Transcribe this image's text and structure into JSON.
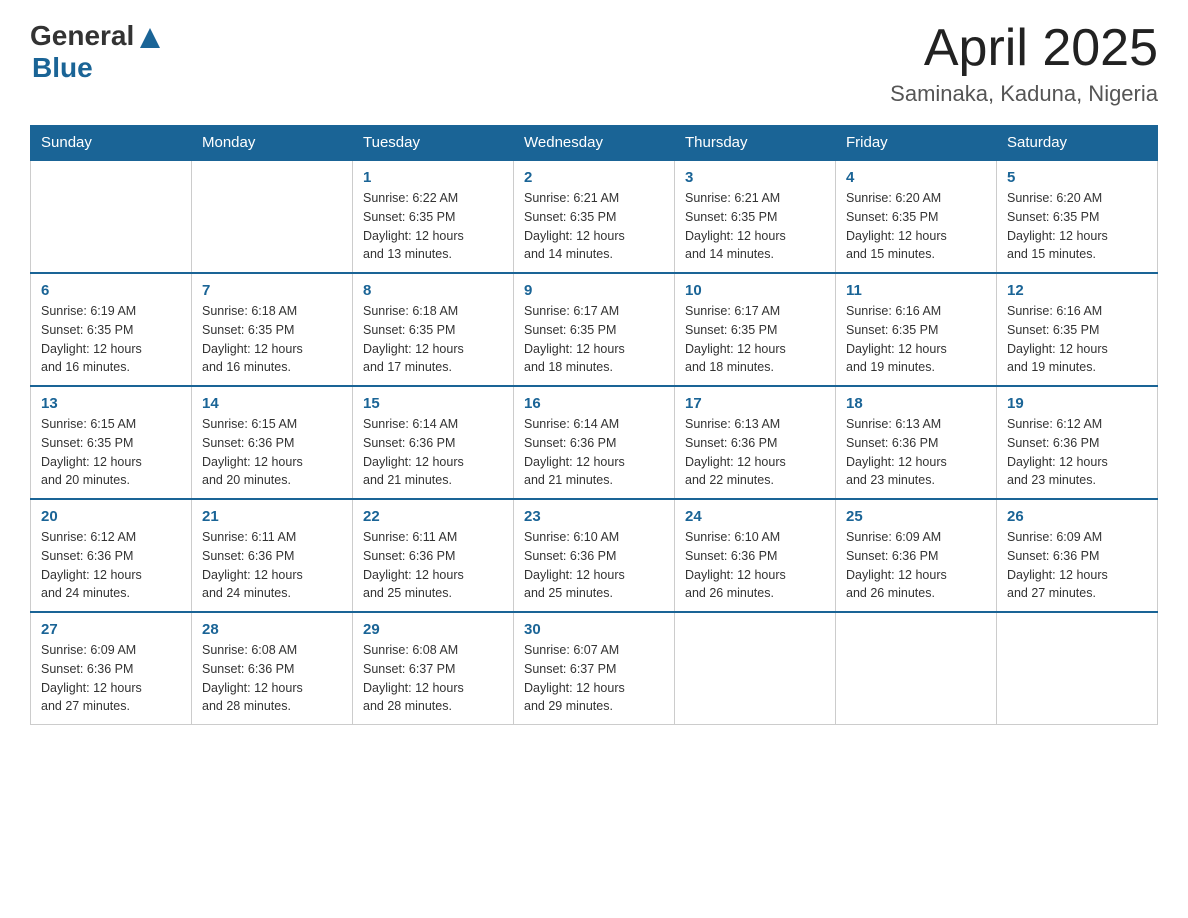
{
  "header": {
    "logo_general": "General",
    "logo_blue": "Blue",
    "title": "April 2025",
    "subtitle": "Saminaka, Kaduna, Nigeria"
  },
  "weekdays": [
    "Sunday",
    "Monday",
    "Tuesday",
    "Wednesday",
    "Thursday",
    "Friday",
    "Saturday"
  ],
  "weeks": [
    [
      {
        "day": "",
        "info": ""
      },
      {
        "day": "",
        "info": ""
      },
      {
        "day": "1",
        "info": "Sunrise: 6:22 AM\nSunset: 6:35 PM\nDaylight: 12 hours\nand 13 minutes."
      },
      {
        "day": "2",
        "info": "Sunrise: 6:21 AM\nSunset: 6:35 PM\nDaylight: 12 hours\nand 14 minutes."
      },
      {
        "day": "3",
        "info": "Sunrise: 6:21 AM\nSunset: 6:35 PM\nDaylight: 12 hours\nand 14 minutes."
      },
      {
        "day": "4",
        "info": "Sunrise: 6:20 AM\nSunset: 6:35 PM\nDaylight: 12 hours\nand 15 minutes."
      },
      {
        "day": "5",
        "info": "Sunrise: 6:20 AM\nSunset: 6:35 PM\nDaylight: 12 hours\nand 15 minutes."
      }
    ],
    [
      {
        "day": "6",
        "info": "Sunrise: 6:19 AM\nSunset: 6:35 PM\nDaylight: 12 hours\nand 16 minutes."
      },
      {
        "day": "7",
        "info": "Sunrise: 6:18 AM\nSunset: 6:35 PM\nDaylight: 12 hours\nand 16 minutes."
      },
      {
        "day": "8",
        "info": "Sunrise: 6:18 AM\nSunset: 6:35 PM\nDaylight: 12 hours\nand 17 minutes."
      },
      {
        "day": "9",
        "info": "Sunrise: 6:17 AM\nSunset: 6:35 PM\nDaylight: 12 hours\nand 18 minutes."
      },
      {
        "day": "10",
        "info": "Sunrise: 6:17 AM\nSunset: 6:35 PM\nDaylight: 12 hours\nand 18 minutes."
      },
      {
        "day": "11",
        "info": "Sunrise: 6:16 AM\nSunset: 6:35 PM\nDaylight: 12 hours\nand 19 minutes."
      },
      {
        "day": "12",
        "info": "Sunrise: 6:16 AM\nSunset: 6:35 PM\nDaylight: 12 hours\nand 19 minutes."
      }
    ],
    [
      {
        "day": "13",
        "info": "Sunrise: 6:15 AM\nSunset: 6:35 PM\nDaylight: 12 hours\nand 20 minutes."
      },
      {
        "day": "14",
        "info": "Sunrise: 6:15 AM\nSunset: 6:36 PM\nDaylight: 12 hours\nand 20 minutes."
      },
      {
        "day": "15",
        "info": "Sunrise: 6:14 AM\nSunset: 6:36 PM\nDaylight: 12 hours\nand 21 minutes."
      },
      {
        "day": "16",
        "info": "Sunrise: 6:14 AM\nSunset: 6:36 PM\nDaylight: 12 hours\nand 21 minutes."
      },
      {
        "day": "17",
        "info": "Sunrise: 6:13 AM\nSunset: 6:36 PM\nDaylight: 12 hours\nand 22 minutes."
      },
      {
        "day": "18",
        "info": "Sunrise: 6:13 AM\nSunset: 6:36 PM\nDaylight: 12 hours\nand 23 minutes."
      },
      {
        "day": "19",
        "info": "Sunrise: 6:12 AM\nSunset: 6:36 PM\nDaylight: 12 hours\nand 23 minutes."
      }
    ],
    [
      {
        "day": "20",
        "info": "Sunrise: 6:12 AM\nSunset: 6:36 PM\nDaylight: 12 hours\nand 24 minutes."
      },
      {
        "day": "21",
        "info": "Sunrise: 6:11 AM\nSunset: 6:36 PM\nDaylight: 12 hours\nand 24 minutes."
      },
      {
        "day": "22",
        "info": "Sunrise: 6:11 AM\nSunset: 6:36 PM\nDaylight: 12 hours\nand 25 minutes."
      },
      {
        "day": "23",
        "info": "Sunrise: 6:10 AM\nSunset: 6:36 PM\nDaylight: 12 hours\nand 25 minutes."
      },
      {
        "day": "24",
        "info": "Sunrise: 6:10 AM\nSunset: 6:36 PM\nDaylight: 12 hours\nand 26 minutes."
      },
      {
        "day": "25",
        "info": "Sunrise: 6:09 AM\nSunset: 6:36 PM\nDaylight: 12 hours\nand 26 minutes."
      },
      {
        "day": "26",
        "info": "Sunrise: 6:09 AM\nSunset: 6:36 PM\nDaylight: 12 hours\nand 27 minutes."
      }
    ],
    [
      {
        "day": "27",
        "info": "Sunrise: 6:09 AM\nSunset: 6:36 PM\nDaylight: 12 hours\nand 27 minutes."
      },
      {
        "day": "28",
        "info": "Sunrise: 6:08 AM\nSunset: 6:36 PM\nDaylight: 12 hours\nand 28 minutes."
      },
      {
        "day": "29",
        "info": "Sunrise: 6:08 AM\nSunset: 6:37 PM\nDaylight: 12 hours\nand 28 minutes."
      },
      {
        "day": "30",
        "info": "Sunrise: 6:07 AM\nSunset: 6:37 PM\nDaylight: 12 hours\nand 29 minutes."
      },
      {
        "day": "",
        "info": ""
      },
      {
        "day": "",
        "info": ""
      },
      {
        "day": "",
        "info": ""
      }
    ]
  ]
}
